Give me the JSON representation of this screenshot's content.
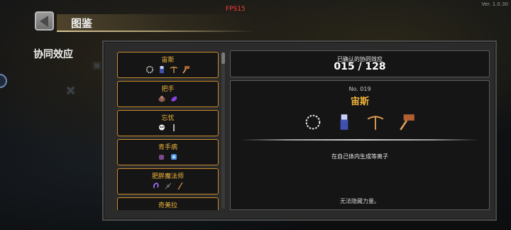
{
  "hud": {
    "fps": "FPS15",
    "version": "Ver. 1.0.30"
  },
  "header": {
    "title": "图鉴",
    "back_icon": "back-arrow-icon"
  },
  "section_title": "协同效应",
  "synergy_list": [
    {
      "name": "宙斯",
      "icons": [
        "ring-icon",
        "blue-figure-icon",
        "crossbow-icon",
        "hammer-icon"
      ]
    },
    {
      "name": "把手",
      "icons": [
        "shield-icon",
        "purple-slug-icon"
      ]
    },
    {
      "name": "忘忧",
      "icons": [
        "skull-icon",
        "sword-icon"
      ]
    },
    {
      "name": "青手病",
      "icons": [
        "purple-hand-icon",
        "blue-glove-icon"
      ]
    },
    {
      "name": "肥胖魔法师",
      "icons": [
        "purple-orb-icon",
        "wand-icon",
        "staff-icon"
      ]
    },
    {
      "name": "奇美拉",
      "icons": []
    }
  ],
  "count": {
    "label": "已确认的协同效应",
    "value": "015 / 128"
  },
  "detail": {
    "number": "No. 019",
    "name": "宙斯",
    "icons": [
      "ring-icon",
      "blue-figure-icon",
      "crossbow-icon",
      "hammer-icon"
    ],
    "description": "在自己体内生成等离子",
    "flavor": "无法隐藏力量。"
  },
  "colors": {
    "accent": "#f0b43c",
    "card_border": "#c98a2a",
    "fps": "#ff3b3b"
  }
}
